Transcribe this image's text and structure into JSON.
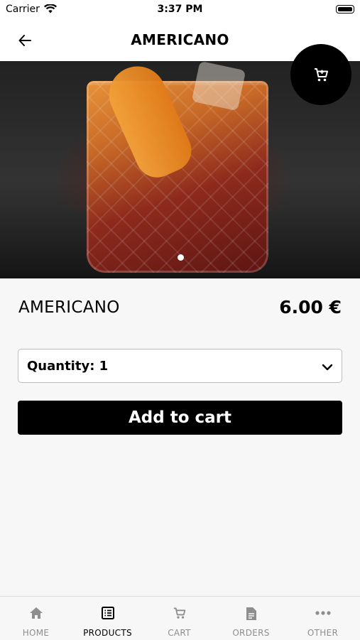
{
  "status_bar": {
    "carrier": "Carrier",
    "time": "3:37 PM"
  },
  "nav": {
    "title": "AMERICANO"
  },
  "product": {
    "name": "AMERICANO",
    "price": "6.00 €",
    "carousel": {
      "pages": 1,
      "current": 1
    }
  },
  "quantity": {
    "label": "Quantity: 1"
  },
  "actions": {
    "add_to_cart": "Add to cart"
  },
  "tabs": [
    {
      "label": "HOME",
      "icon": "home-icon",
      "active": false
    },
    {
      "label": "PRODUCTS",
      "icon": "list-icon",
      "active": true
    },
    {
      "label": "CART",
      "icon": "cart-icon",
      "active": false
    },
    {
      "label": "ORDERS",
      "icon": "document-icon",
      "active": false
    },
    {
      "label": "OTHER",
      "icon": "more-icon",
      "active": false
    }
  ],
  "colors": {
    "primary": "#000000",
    "background": "#f7f7f7",
    "inactive_tab": "#8e8e8e"
  }
}
